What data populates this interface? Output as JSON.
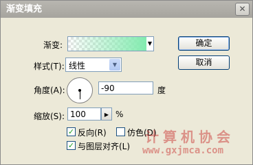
{
  "dialog": {
    "title": "渐变填充"
  },
  "close_glyph": "✕",
  "gradient": {
    "label": "渐变:",
    "dropdown_glyph": "▼"
  },
  "buttons": {
    "ok": "确定",
    "cancel": "取消"
  },
  "style": {
    "label": "样式(T):",
    "value": "线性",
    "arrow_glyph": "▼"
  },
  "angle": {
    "label": "角度(A):",
    "value": "-90",
    "unit": "度"
  },
  "scale": {
    "label": "缩放(S):",
    "value": "100",
    "spin_glyph": "▶",
    "unit": "%"
  },
  "options": {
    "reverse": {
      "label": "反向(R)",
      "checked": true
    },
    "dither": {
      "label": "仿色(D)",
      "checked": false
    },
    "align": {
      "label": "与图层对齐(L)",
      "checked": true
    }
  },
  "checkmark": "✓",
  "watermark": {
    "text_cn": "计算机协会",
    "text_url": "www.gxjmca.com"
  },
  "colors": {
    "gradient_end": "#82ebaf",
    "title_bar": "#aaa8a2"
  }
}
